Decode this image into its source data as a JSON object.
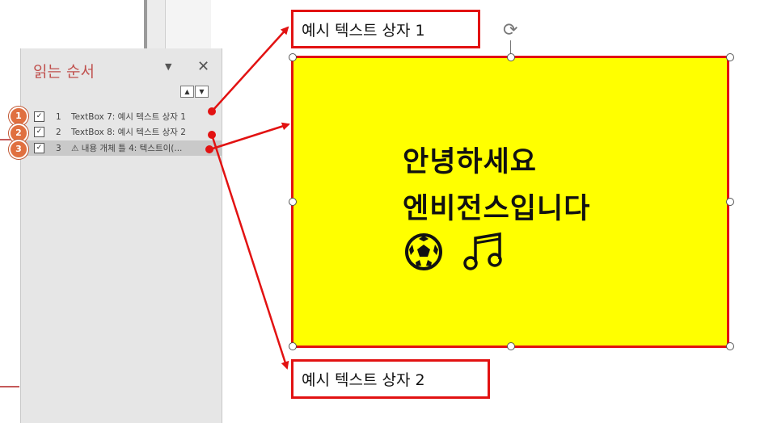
{
  "pane": {
    "title": "읽는 순서",
    "dropdown_glyph": "▼",
    "close_glyph": "✕",
    "move_up_glyph": "▲",
    "move_down_glyph": "▼",
    "items": [
      {
        "badge": "1",
        "checked": "✓",
        "number": "1",
        "label": "TextBox 7: 예시 텍스트 상자 1"
      },
      {
        "badge": "2",
        "checked": "✓",
        "number": "2",
        "label": "TextBox 8: 예시 텍스트 상자 2"
      },
      {
        "badge": "3",
        "checked": "✓",
        "number": "3",
        "label": "⚠ 내용 개체 틀 4: 텍스트이(..."
      }
    ]
  },
  "slide": {
    "textbox1": "예시 텍스트 상자 1",
    "textbox2": "예시 텍스트 상자 2",
    "content_line1": "안녕하세요",
    "content_line2": "엔비전스입니다",
    "soccer_icon": "soccer-ball-icon",
    "music_icon": "music-notes-icon"
  },
  "colors": {
    "accent": "#e21212",
    "pane_title": "#c0504d",
    "content_fill": "#ffff00",
    "badge": "#e07040"
  }
}
